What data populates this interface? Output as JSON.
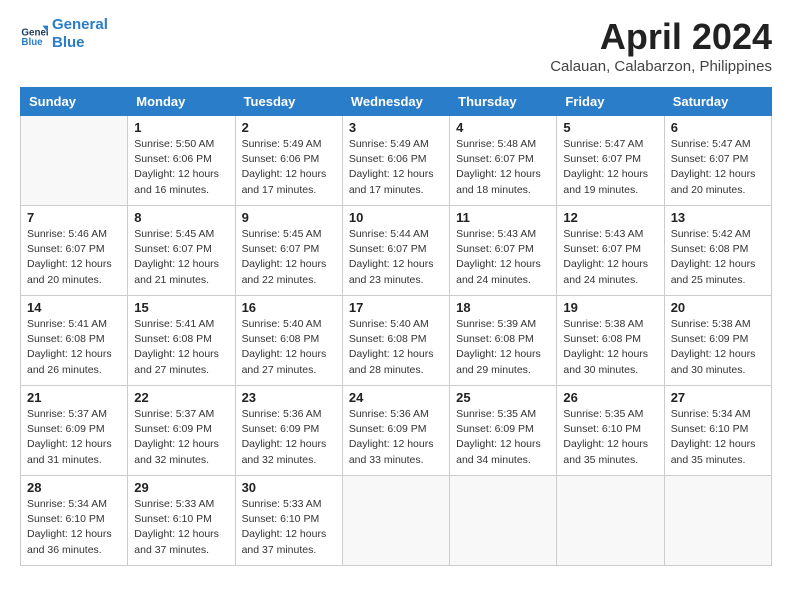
{
  "header": {
    "logo_line1": "General",
    "logo_line2": "Blue",
    "title": "April 2024",
    "subtitle": "Calauan, Calabarzon, Philippines"
  },
  "calendar": {
    "days_of_week": [
      "Sunday",
      "Monday",
      "Tuesday",
      "Wednesday",
      "Thursday",
      "Friday",
      "Saturday"
    ],
    "weeks": [
      [
        {
          "day": "",
          "detail": ""
        },
        {
          "day": "1",
          "detail": "Sunrise: 5:50 AM\nSunset: 6:06 PM\nDaylight: 12 hours\nand 16 minutes."
        },
        {
          "day": "2",
          "detail": "Sunrise: 5:49 AM\nSunset: 6:06 PM\nDaylight: 12 hours\nand 17 minutes."
        },
        {
          "day": "3",
          "detail": "Sunrise: 5:49 AM\nSunset: 6:06 PM\nDaylight: 12 hours\nand 17 minutes."
        },
        {
          "day": "4",
          "detail": "Sunrise: 5:48 AM\nSunset: 6:07 PM\nDaylight: 12 hours\nand 18 minutes."
        },
        {
          "day": "5",
          "detail": "Sunrise: 5:47 AM\nSunset: 6:07 PM\nDaylight: 12 hours\nand 19 minutes."
        },
        {
          "day": "6",
          "detail": "Sunrise: 5:47 AM\nSunset: 6:07 PM\nDaylight: 12 hours\nand 20 minutes."
        }
      ],
      [
        {
          "day": "7",
          "detail": "Sunrise: 5:46 AM\nSunset: 6:07 PM\nDaylight: 12 hours\nand 20 minutes."
        },
        {
          "day": "8",
          "detail": "Sunrise: 5:45 AM\nSunset: 6:07 PM\nDaylight: 12 hours\nand 21 minutes."
        },
        {
          "day": "9",
          "detail": "Sunrise: 5:45 AM\nSunset: 6:07 PM\nDaylight: 12 hours\nand 22 minutes."
        },
        {
          "day": "10",
          "detail": "Sunrise: 5:44 AM\nSunset: 6:07 PM\nDaylight: 12 hours\nand 23 minutes."
        },
        {
          "day": "11",
          "detail": "Sunrise: 5:43 AM\nSunset: 6:07 PM\nDaylight: 12 hours\nand 24 minutes."
        },
        {
          "day": "12",
          "detail": "Sunrise: 5:43 AM\nSunset: 6:07 PM\nDaylight: 12 hours\nand 24 minutes."
        },
        {
          "day": "13",
          "detail": "Sunrise: 5:42 AM\nSunset: 6:08 PM\nDaylight: 12 hours\nand 25 minutes."
        }
      ],
      [
        {
          "day": "14",
          "detail": "Sunrise: 5:41 AM\nSunset: 6:08 PM\nDaylight: 12 hours\nand 26 minutes."
        },
        {
          "day": "15",
          "detail": "Sunrise: 5:41 AM\nSunset: 6:08 PM\nDaylight: 12 hours\nand 27 minutes."
        },
        {
          "day": "16",
          "detail": "Sunrise: 5:40 AM\nSunset: 6:08 PM\nDaylight: 12 hours\nand 27 minutes."
        },
        {
          "day": "17",
          "detail": "Sunrise: 5:40 AM\nSunset: 6:08 PM\nDaylight: 12 hours\nand 28 minutes."
        },
        {
          "day": "18",
          "detail": "Sunrise: 5:39 AM\nSunset: 6:08 PM\nDaylight: 12 hours\nand 29 minutes."
        },
        {
          "day": "19",
          "detail": "Sunrise: 5:38 AM\nSunset: 6:08 PM\nDaylight: 12 hours\nand 30 minutes."
        },
        {
          "day": "20",
          "detail": "Sunrise: 5:38 AM\nSunset: 6:09 PM\nDaylight: 12 hours\nand 30 minutes."
        }
      ],
      [
        {
          "day": "21",
          "detail": "Sunrise: 5:37 AM\nSunset: 6:09 PM\nDaylight: 12 hours\nand 31 minutes."
        },
        {
          "day": "22",
          "detail": "Sunrise: 5:37 AM\nSunset: 6:09 PM\nDaylight: 12 hours\nand 32 minutes."
        },
        {
          "day": "23",
          "detail": "Sunrise: 5:36 AM\nSunset: 6:09 PM\nDaylight: 12 hours\nand 32 minutes."
        },
        {
          "day": "24",
          "detail": "Sunrise: 5:36 AM\nSunset: 6:09 PM\nDaylight: 12 hours\nand 33 minutes."
        },
        {
          "day": "25",
          "detail": "Sunrise: 5:35 AM\nSunset: 6:09 PM\nDaylight: 12 hours\nand 34 minutes."
        },
        {
          "day": "26",
          "detail": "Sunrise: 5:35 AM\nSunset: 6:10 PM\nDaylight: 12 hours\nand 35 minutes."
        },
        {
          "day": "27",
          "detail": "Sunrise: 5:34 AM\nSunset: 6:10 PM\nDaylight: 12 hours\nand 35 minutes."
        }
      ],
      [
        {
          "day": "28",
          "detail": "Sunrise: 5:34 AM\nSunset: 6:10 PM\nDaylight: 12 hours\nand 36 minutes."
        },
        {
          "day": "29",
          "detail": "Sunrise: 5:33 AM\nSunset: 6:10 PM\nDaylight: 12 hours\nand 37 minutes."
        },
        {
          "day": "30",
          "detail": "Sunrise: 5:33 AM\nSunset: 6:10 PM\nDaylight: 12 hours\nand 37 minutes."
        },
        {
          "day": "",
          "detail": ""
        },
        {
          "day": "",
          "detail": ""
        },
        {
          "day": "",
          "detail": ""
        },
        {
          "day": "",
          "detail": ""
        }
      ]
    ]
  }
}
